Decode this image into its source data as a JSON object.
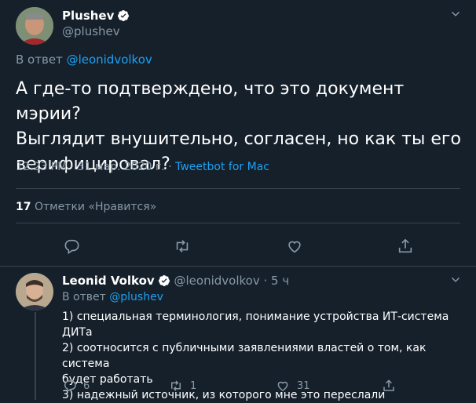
{
  "main_tweet": {
    "author_name": "Plushev",
    "author_handle": "@plushev",
    "reply_prefix": "В ответ",
    "reply_to": "@leonidvolkov",
    "line1": "А где-то подтверждено, что это документ мэрии?",
    "line2": "Выглядит внушительно, согласен, но как ты его",
    "line3": "верифицировал?",
    "time": "12:23 PM · 31 мар. 2020 г. · ",
    "source": "Tweetbot for Mac",
    "likes_count": "17",
    "likes_label": "Отметки «Нравится»"
  },
  "reply_tweet": {
    "author_name": "Leonid Volkov",
    "author_handle": "@leonidvolkov",
    "time_ago": "· 5 ч",
    "reply_prefix": "В ответ",
    "reply_to": "@plushev",
    "lines": [
      "1) специальная терминология, понимание устройства ИТ-система ДИТа",
      "2) соотносится с публичными заявлениями властей о том, как система",
      "будет работать",
      "3) надежный источник, из которого мне это переслали"
    ],
    "reply_count": "6",
    "retweet_count": "1",
    "like_count": "31"
  },
  "icons": {
    "verified": "verified-badge-icon",
    "more": "chevron-down-icon",
    "reply": "reply-icon",
    "retweet": "retweet-icon",
    "like": "heart-icon",
    "share": "share-icon"
  },
  "colors": {
    "background": "#15202b",
    "accent": "#1da1f2",
    "muted": "#8899a6",
    "divider": "#38444d"
  }
}
